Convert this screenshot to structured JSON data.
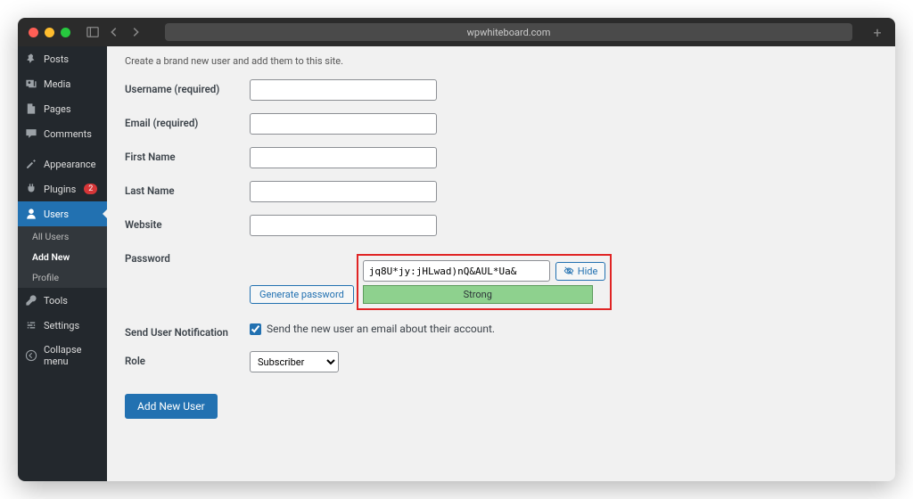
{
  "url": "wpwhiteboard.com",
  "sidebar": {
    "items": {
      "posts": "Posts",
      "media": "Media",
      "pages": "Pages",
      "comments": "Comments",
      "appearance": "Appearance",
      "plugins": "Plugins",
      "plugins_badge": "2",
      "users": "Users",
      "tools": "Tools",
      "settings": "Settings",
      "collapse": "Collapse menu"
    },
    "sub": {
      "all_users": "All Users",
      "add_new": "Add New",
      "profile": "Profile"
    }
  },
  "main": {
    "intro": "Create a brand new user and add them to this site.",
    "labels": {
      "username": "Username (required)",
      "email": "Email (required)",
      "first_name": "First Name",
      "last_name": "Last Name",
      "website": "Website",
      "password": "Password",
      "send_notification": "Send User Notification",
      "role": "Role"
    },
    "generate_password": "Generate password",
    "password_value": "jq8U*jy:jHLwad)nQ&AUL*Ua&",
    "hide_label": "Hide",
    "strength": "Strong",
    "notification_text": "Send the new user an email about their account.",
    "role_value": "Subscriber",
    "submit": "Add New User"
  }
}
